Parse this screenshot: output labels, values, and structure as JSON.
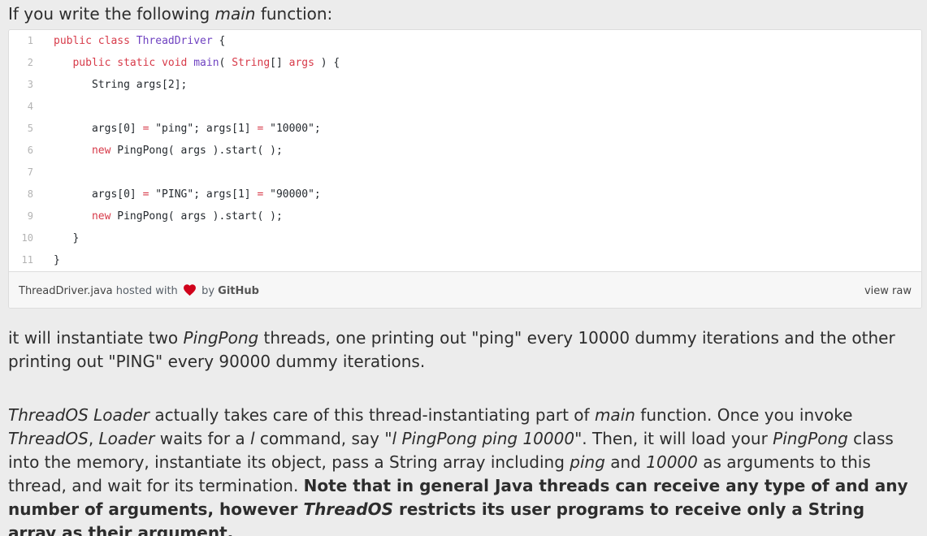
{
  "intro": {
    "prefix": "If you write the following ",
    "em": "main",
    "suffix": " function:"
  },
  "gist": {
    "lines": [
      {
        "n": "1",
        "parts": [
          [
            "kw",
            "public "
          ],
          [
            "kw",
            "class "
          ],
          [
            "ty",
            "ThreadDriver"
          ],
          [
            "t",
            " {"
          ]
        ]
      },
      {
        "n": "2",
        "parts": [
          [
            "t",
            "   "
          ],
          [
            "kw",
            "public "
          ],
          [
            "kw",
            "static "
          ],
          [
            "kw",
            "void "
          ],
          [
            "ty",
            "main"
          ],
          [
            "t",
            "( "
          ],
          [
            "kw",
            "String"
          ],
          [
            "t",
            "[] "
          ],
          [
            "kw",
            "args"
          ],
          [
            "t",
            " ) {"
          ]
        ]
      },
      {
        "n": "3",
        "parts": [
          [
            "t",
            "      String args[2];"
          ]
        ]
      },
      {
        "n": "4",
        "parts": [
          [
            "t",
            ""
          ]
        ]
      },
      {
        "n": "5",
        "parts": [
          [
            "t",
            "      args[0] "
          ],
          [
            "op",
            "="
          ],
          [
            "t",
            " \"ping\"; args[1] "
          ],
          [
            "op",
            "="
          ],
          [
            "t",
            " \"10000\";"
          ]
        ]
      },
      {
        "n": "6",
        "parts": [
          [
            "t",
            "      "
          ],
          [
            "kw",
            "new "
          ],
          [
            "t",
            "PingPong( args ).start( );"
          ]
        ]
      },
      {
        "n": "7",
        "parts": [
          [
            "t",
            ""
          ]
        ]
      },
      {
        "n": "8",
        "parts": [
          [
            "t",
            "      args[0] "
          ],
          [
            "op",
            "="
          ],
          [
            "t",
            " \"PING\"; args[1] "
          ],
          [
            "op",
            "="
          ],
          [
            "t",
            " \"90000\";"
          ]
        ]
      },
      {
        "n": "9",
        "parts": [
          [
            "t",
            "      "
          ],
          [
            "kw",
            "new "
          ],
          [
            "t",
            "PingPong( args ).start( );"
          ]
        ]
      },
      {
        "n": "10",
        "parts": [
          [
            "t",
            "   }"
          ]
        ]
      },
      {
        "n": "11",
        "parts": [
          [
            "t",
            "}"
          ]
        ]
      }
    ],
    "file_name": "ThreadDriver.java",
    "hosted_with": " hosted with ",
    "by": " by ",
    "host": "GitHub",
    "view_raw": "view raw",
    "heart_color": "#d0021b"
  },
  "p1": {
    "a": "it will instantiate two ",
    "b": "PingPong",
    "c": " threads, one printing out \"ping\" every 10000 dummy iterations and the other printing out \"PING\" every 90000 dummy iterations."
  },
  "p2": {
    "s1": "ThreadOS Loader",
    "s2": " actually takes care of this thread-instantiating part of ",
    "s3": "main",
    "s4": " function. Once you invoke ",
    "s5": "ThreadOS",
    "s6": ", ",
    "s7": "Loader",
    "s8": " waits for a ",
    "s9": "l",
    "s10": " command, say ",
    "s11": "\"l PingPong ping 10000\"",
    "s12": ". Then, it will load your ",
    "s13": "PingPong",
    "s14": " class into the memory, instantiate its object, pass a String array including ",
    "s15": "ping",
    "s16": " and ",
    "s17": "10000",
    "s18": " as arguments to this thread, and wait for its termination. ",
    "s19": "Note that in general Java threads can receive any type of and any number of arguments, however ",
    "s20": "ThreadOS",
    "s21": " restricts its user programs to receive only a String array as their argument."
  }
}
